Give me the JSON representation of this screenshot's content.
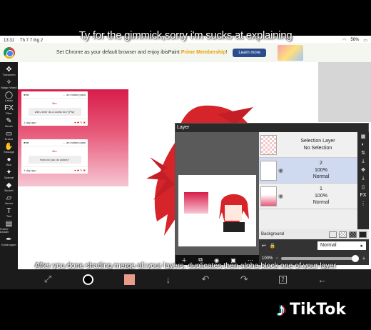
{
  "captions": {
    "top": "Ty for the gimmick,sorry i'm sucks at explaining",
    "bottom": "After you done shading merge all your layers, duplicates then alpha block one of your layer"
  },
  "status": {
    "time": "13:31",
    "date": "Th 7 7 thg 2",
    "battery": "56%"
  },
  "ad": {
    "text": "Set Chrome as your default browser and enjoy ibisPaint",
    "highlight": "Prime Membership",
    "tail": "!",
    "button": "Learn more"
  },
  "toolbar": {
    "tools": [
      {
        "icon": "✥",
        "label": "Transform"
      },
      {
        "icon": "✧",
        "label": "Magic Wand"
      },
      {
        "icon": "◯",
        "label": "Lasso"
      },
      {
        "icon": "FX",
        "label": "Filter"
      },
      {
        "icon": "✎",
        "label": "Brush"
      },
      {
        "icon": "▭",
        "label": "Eraser"
      },
      {
        "icon": "✋",
        "label": "Smudge"
      },
      {
        "icon": "●",
        "label": "Blur"
      },
      {
        "icon": "✦",
        "label": "Special"
      },
      {
        "icon": "◆",
        "label": "Bucket"
      },
      {
        "icon": "▱",
        "label": "Vector"
      },
      {
        "icon": "T",
        "label": "Text"
      },
      {
        "icon": "▤",
        "label": "Frame Divider"
      },
      {
        "icon": "✒",
        "label": "Eyedropper"
      }
    ]
  },
  "mock": {
    "card1": {
      "name": "Bru",
      "question": "will u ever do a comic bu? (Plz)",
      "time": "1 day ago",
      "more": "← an instant pays"
    },
    "card2": {
      "name": "Bru",
      "question": "How do you do colors?",
      "time": "1 day ago",
      "more": "← an instant pays"
    }
  },
  "layer_panel": {
    "title": "Layer",
    "selection": {
      "name": "Selection Layer",
      "status": "No Selection"
    },
    "layers": [
      {
        "number": "2",
        "opacity": "100%",
        "mode": "Normal"
      },
      {
        "number": "1",
        "opacity": "100%",
        "mode": "Normal"
      }
    ],
    "background_label": "Background",
    "blend_mode": "Normal",
    "opacity_label": "100%"
  },
  "bottom": {
    "layer_count": "2"
  },
  "brand": {
    "name": "TikTok"
  }
}
